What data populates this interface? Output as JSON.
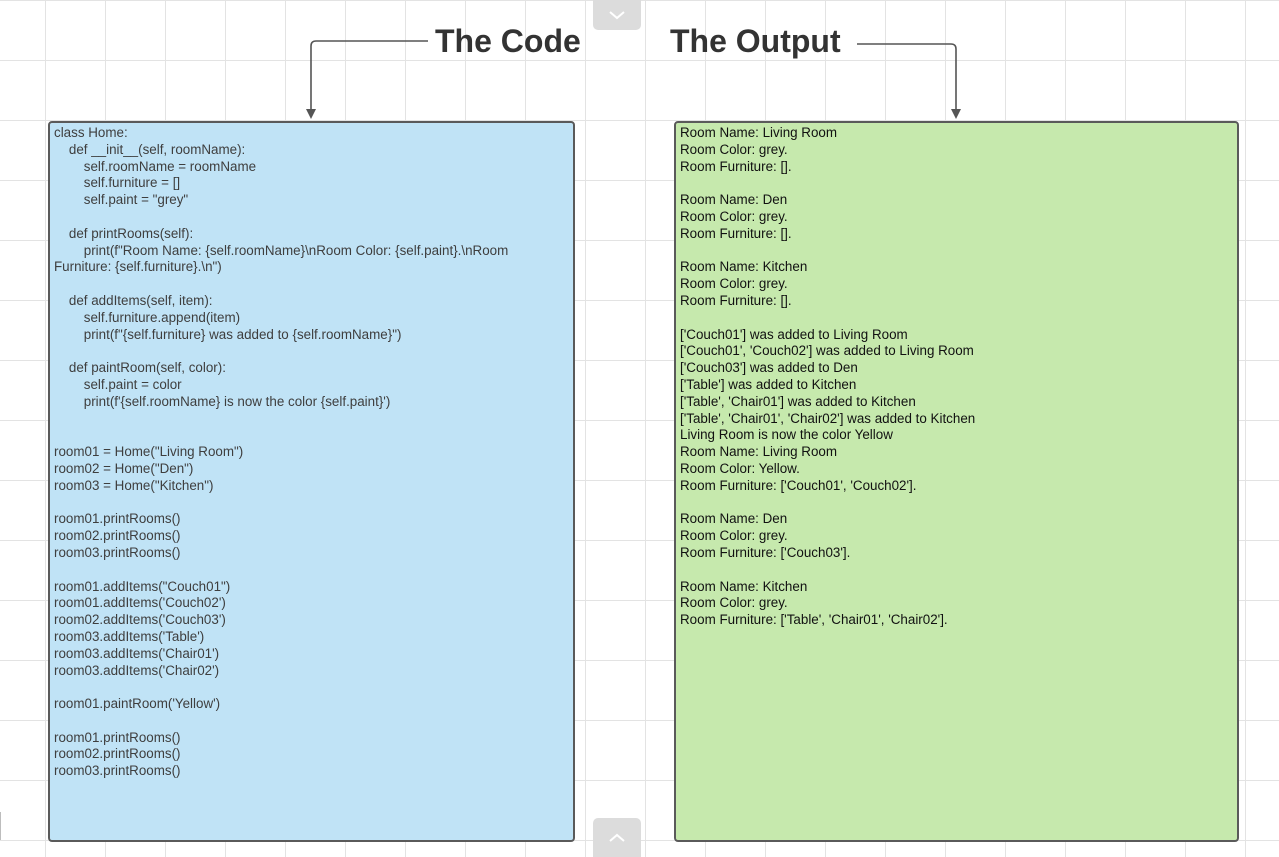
{
  "headings": {
    "code": "The Code",
    "output": "The Output"
  },
  "colors": {
    "code_panel": "#c0e3f6",
    "output_panel": "#c6e9ad",
    "panel_border": "#5a5a5a",
    "connector": "#555555",
    "grid": "#e3e3e3",
    "tab": "#dcdcdc"
  },
  "code_panel": {
    "text": "class Home:\n    def __init__(self, roomName):\n        self.roomName = roomName\n        self.furniture = []\n        self.paint = \"grey\"\n\n    def printRooms(self):\n        print(f\"Room Name: {self.roomName}\\nRoom Color: {self.paint}.\\nRoom Furniture: {self.furniture}.\\n\")\n\n    def addItems(self, item):\n        self.furniture.append(item)\n        print(f\"{self.furniture} was added to {self.roomName}\")\n\n    def paintRoom(self, color):\n        self.paint = color\n        print(f'{self.roomName} is now the color {self.paint}')\n\n\nroom01 = Home(\"Living Room\")\nroom02 = Home(\"Den\")\nroom03 = Home(\"Kitchen\")\n\nroom01.printRooms()\nroom02.printRooms()\nroom03.printRooms()\n\nroom01.addItems(\"Couch01\")\nroom01.addItems('Couch02')\nroom02.addItems('Couch03')\nroom03.addItems('Table')\nroom03.addItems('Chair01')\nroom03.addItems('Chair02')\n\nroom01.paintRoom('Yellow')\n\nroom01.printRooms()\nroom02.printRooms()\nroom03.printRooms()"
  },
  "output_panel": {
    "text": "Room Name: Living Room\nRoom Color: grey.\nRoom Furniture: [].\n\nRoom Name: Den\nRoom Color: grey.\nRoom Furniture: [].\n\nRoom Name: Kitchen\nRoom Color: grey.\nRoom Furniture: [].\n\n['Couch01'] was added to Living Room\n['Couch01', 'Couch02'] was added to Living Room\n['Couch03'] was added to Den\n['Table'] was added to Kitchen\n['Table', 'Chair01'] was added to Kitchen\n['Table', 'Chair01', 'Chair02'] was added to Kitchen\nLiving Room is now the color Yellow\nRoom Name: Living Room\nRoom Color: Yellow.\nRoom Furniture: ['Couch01', 'Couch02'].\n\nRoom Name: Den\nRoom Color: grey.\nRoom Furniture: ['Couch03'].\n\nRoom Name: Kitchen\nRoom Color: grey.\nRoom Furniture: ['Table', 'Chair01', 'Chair02']."
  },
  "icons": {
    "top_tab": "chevron-down-icon",
    "bottom_tab": "chevron-up-icon"
  }
}
